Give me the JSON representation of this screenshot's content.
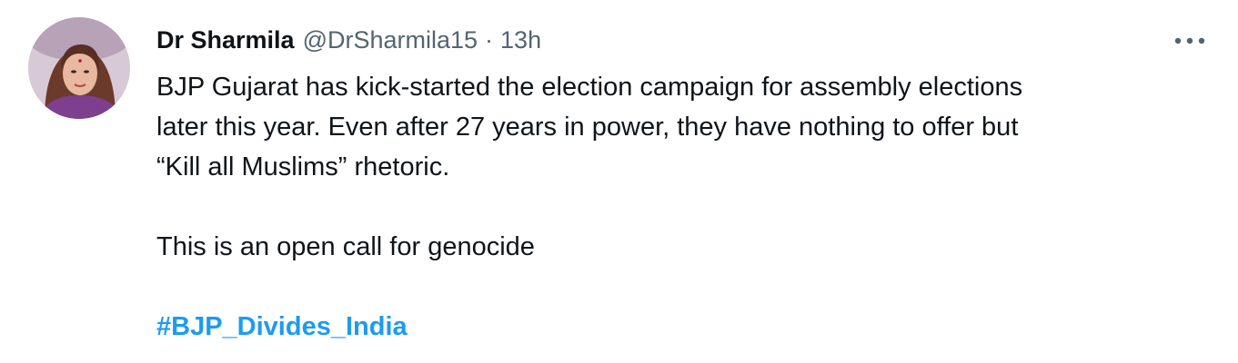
{
  "tweet": {
    "author": {
      "display_name": "Dr Sharmila",
      "handle": "@DrSharmila15",
      "separator": "·",
      "time": "13h",
      "avatar_icon": "profile-avatar"
    },
    "more_icon": "more-options-icon",
    "text": {
      "line1": "BJP Gujarat has kick-started the election campaign for assembly elections",
      "line2": "later this year. Even after 27 years in power, they have nothing to offer but",
      "line3": "“Kill all Muslims” rhetoric.",
      "paragraph2": "This is an open call for genocide",
      "hashtag": "#BJP_Divides_India"
    },
    "colors": {
      "text": "#0f1419",
      "secondary": "#536471",
      "link": "#1d9bf0"
    }
  }
}
